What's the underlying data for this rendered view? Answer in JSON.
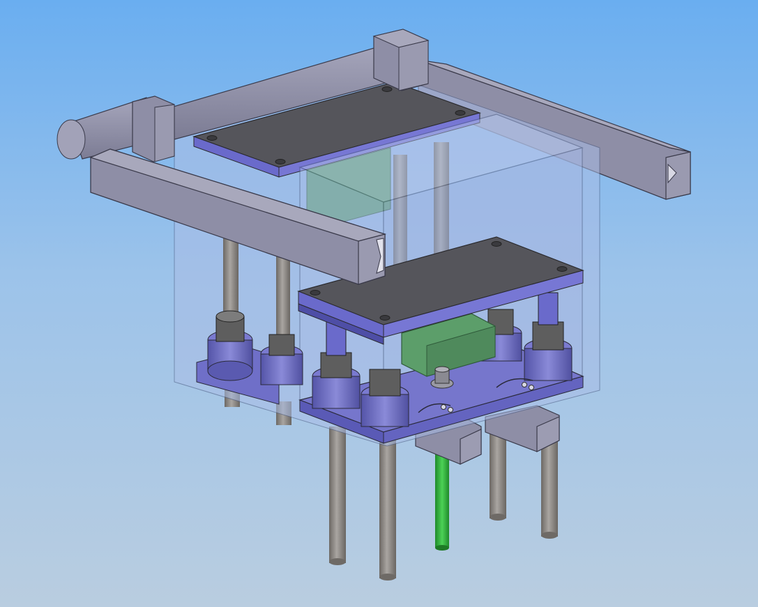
{
  "scene": {
    "subject": "cad-assembly-isometric",
    "colors": {
      "background_top": "#6aaef0",
      "background_bottom": "#b9cde0",
      "frame_gray": "#8e8ea6",
      "plate_dark": "#4e4e54",
      "plate_purple": "#6f6fc8",
      "rod_gray": "#8a8682",
      "block_green": "#5c9e6a",
      "rod_green": "#2fa83a",
      "enclosure_blue": "#a9bde6"
    }
  }
}
